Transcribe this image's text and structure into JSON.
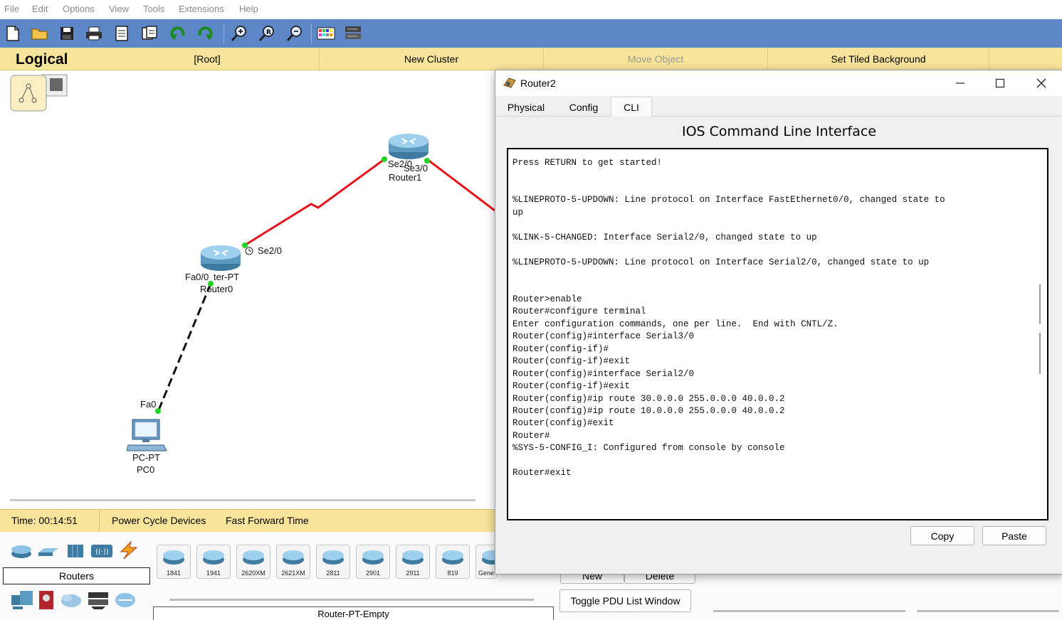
{
  "menu": {
    "file": "File",
    "edit": "Edit",
    "options": "Options",
    "view": "View",
    "tools": "Tools",
    "extensions": "Extensions",
    "help": "Help"
  },
  "logical_bar": {
    "title": "Logical",
    "root": "[Root]",
    "new_cluster": "New Cluster",
    "move_object": "Move Object",
    "set_tiled_background": "Set Tiled Background"
  },
  "topology": {
    "router1": {
      "model": "Router1",
      "port_left": "Se2/0",
      "port_right": "Se3/0"
    },
    "router0": {
      "model": "Router-PT",
      "name": "Router0",
      "port_serial": "Se2/0",
      "port_fast": "Fa0/0",
      "model_visible": "ter-PT",
      "name_visible": "Router0"
    },
    "pc0": {
      "model": "PC-PT",
      "name": "PC0",
      "port": "Fa0"
    }
  },
  "status": {
    "time": "Time: 00:14:51",
    "power_cycle": "Power Cycle Devices",
    "fast_forward": "Fast Forward Time"
  },
  "device_panel": {
    "category_label": "Routers",
    "models": [
      "1841",
      "1941",
      "2620XM",
      "2621XM",
      "2811",
      "2901",
      "2911",
      "819",
      "Gene"
    ],
    "selected_model": "Router-PT-Empty"
  },
  "pdu": {
    "new": "New",
    "delete": "Delete",
    "toggle": "Toggle PDU List Window"
  },
  "dialog": {
    "title": "Router2",
    "tabs": [
      "Physical",
      "Config",
      "CLI"
    ],
    "active_tab": "CLI",
    "heading": "IOS Command Line Interface",
    "copy": "Copy",
    "paste": "Paste",
    "cli_lines": [
      "Press RETURN to get started!",
      "",
      "",
      "%LINEPROTO-5-UPDOWN: Line protocol on Interface FastEthernet0/0, changed state to",
      "up",
      "",
      "%LINK-5-CHANGED: Interface Serial2/0, changed state to up",
      "",
      "%LINEPROTO-5-UPDOWN: Line protocol on Interface Serial2/0, changed state to up",
      "",
      "",
      "Router>enable",
      "Router#configure terminal",
      "Enter configuration commands, one per line.  End with CNTL/Z.",
      "Router(config)#interface Serial3/0",
      "Router(config-if)#",
      "Router(config-if)#exit",
      "Router(config)#interface Serial2/0",
      "Router(config-if)#exit",
      "Router(config)#ip route 30.0.0.0 255.0.0.0 40.0.0.2",
      "Router(config)#ip route 10.0.0.0 255.0.0.0 40.0.0.2",
      "Router(config)#exit",
      "Router#",
      "%SYS-5-CONFIG_I: Configured from console by console",
      "",
      "Router#exit"
    ]
  },
  "colors": {
    "toolbar": "#5d86c7",
    "logical_bar": "#f8e49b",
    "link_serial": "#e8141c",
    "link_up": "#1fd41f"
  }
}
